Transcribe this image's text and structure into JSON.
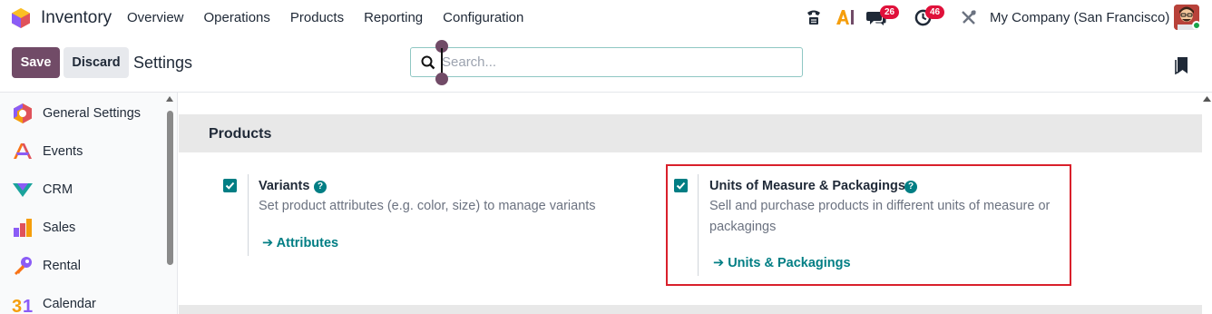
{
  "navbar": {
    "app_name": "Inventory",
    "menu": [
      "Overview",
      "Operations",
      "Products",
      "Reporting",
      "Configuration"
    ],
    "chat_count": "26",
    "activity_count": "46",
    "company": "My Company (San Francisco)"
  },
  "control_panel": {
    "save_label": "Save",
    "discard_label": "Discard",
    "breadcrumb": "Settings",
    "search_placeholder": "Search...",
    "search_value": ""
  },
  "sidebar": {
    "items": [
      {
        "label": "General Settings",
        "icon": "general-settings-icon"
      },
      {
        "label": "Events",
        "icon": "events-icon"
      },
      {
        "label": "CRM",
        "icon": "crm-icon"
      },
      {
        "label": "Sales",
        "icon": "sales-icon"
      },
      {
        "label": "Rental",
        "icon": "rental-icon"
      },
      {
        "label": "Calendar",
        "icon": "calendar-icon"
      }
    ]
  },
  "section": {
    "title": "Products",
    "settings": [
      {
        "title": "Variants",
        "checked": true,
        "description": "Set product attributes (e.g. color, size) to manage variants",
        "link": "Attributes"
      },
      {
        "title": "Units of Measure & Packagings",
        "checked": true,
        "description": "Sell and purchase products in different units of measure or packagings",
        "link": "Units & Packagings"
      }
    ]
  },
  "colors": {
    "brand": "#714b67",
    "accent": "#017e84",
    "highlight": "#d9202b"
  }
}
